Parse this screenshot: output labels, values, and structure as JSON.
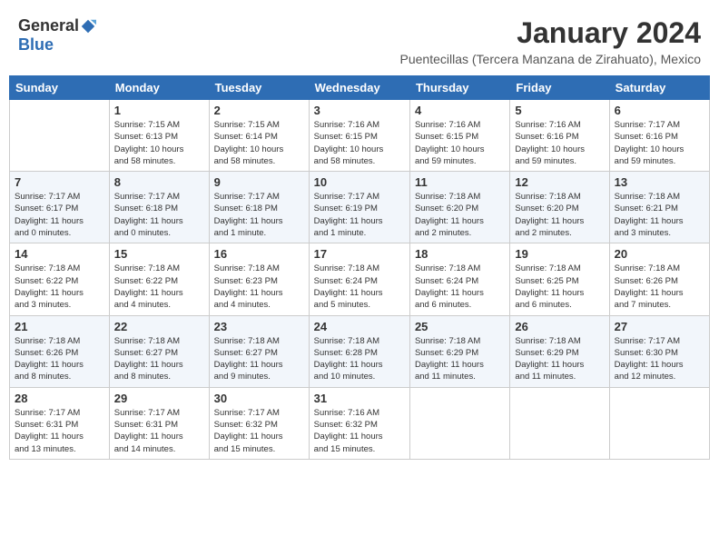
{
  "header": {
    "logo_general": "General",
    "logo_blue": "Blue",
    "month_title": "January 2024",
    "location": "Puentecillas (Tercera Manzana de Zirahuato), Mexico"
  },
  "days_of_week": [
    "Sunday",
    "Monday",
    "Tuesday",
    "Wednesday",
    "Thursday",
    "Friday",
    "Saturday"
  ],
  "weeks": [
    [
      {
        "day": "",
        "info": ""
      },
      {
        "day": "1",
        "info": "Sunrise: 7:15 AM\nSunset: 6:13 PM\nDaylight: 10 hours\nand 58 minutes."
      },
      {
        "day": "2",
        "info": "Sunrise: 7:15 AM\nSunset: 6:14 PM\nDaylight: 10 hours\nand 58 minutes."
      },
      {
        "day": "3",
        "info": "Sunrise: 7:16 AM\nSunset: 6:15 PM\nDaylight: 10 hours\nand 58 minutes."
      },
      {
        "day": "4",
        "info": "Sunrise: 7:16 AM\nSunset: 6:15 PM\nDaylight: 10 hours\nand 59 minutes."
      },
      {
        "day": "5",
        "info": "Sunrise: 7:16 AM\nSunset: 6:16 PM\nDaylight: 10 hours\nand 59 minutes."
      },
      {
        "day": "6",
        "info": "Sunrise: 7:17 AM\nSunset: 6:16 PM\nDaylight: 10 hours\nand 59 minutes."
      }
    ],
    [
      {
        "day": "7",
        "info": "Sunrise: 7:17 AM\nSunset: 6:17 PM\nDaylight: 11 hours\nand 0 minutes."
      },
      {
        "day": "8",
        "info": "Sunrise: 7:17 AM\nSunset: 6:18 PM\nDaylight: 11 hours\nand 0 minutes."
      },
      {
        "day": "9",
        "info": "Sunrise: 7:17 AM\nSunset: 6:18 PM\nDaylight: 11 hours\nand 1 minute."
      },
      {
        "day": "10",
        "info": "Sunrise: 7:17 AM\nSunset: 6:19 PM\nDaylight: 11 hours\nand 1 minute."
      },
      {
        "day": "11",
        "info": "Sunrise: 7:18 AM\nSunset: 6:20 PM\nDaylight: 11 hours\nand 2 minutes."
      },
      {
        "day": "12",
        "info": "Sunrise: 7:18 AM\nSunset: 6:20 PM\nDaylight: 11 hours\nand 2 minutes."
      },
      {
        "day": "13",
        "info": "Sunrise: 7:18 AM\nSunset: 6:21 PM\nDaylight: 11 hours\nand 3 minutes."
      }
    ],
    [
      {
        "day": "14",
        "info": "Sunrise: 7:18 AM\nSunset: 6:22 PM\nDaylight: 11 hours\nand 3 minutes."
      },
      {
        "day": "15",
        "info": "Sunrise: 7:18 AM\nSunset: 6:22 PM\nDaylight: 11 hours\nand 4 minutes."
      },
      {
        "day": "16",
        "info": "Sunrise: 7:18 AM\nSunset: 6:23 PM\nDaylight: 11 hours\nand 4 minutes."
      },
      {
        "day": "17",
        "info": "Sunrise: 7:18 AM\nSunset: 6:24 PM\nDaylight: 11 hours\nand 5 minutes."
      },
      {
        "day": "18",
        "info": "Sunrise: 7:18 AM\nSunset: 6:24 PM\nDaylight: 11 hours\nand 6 minutes."
      },
      {
        "day": "19",
        "info": "Sunrise: 7:18 AM\nSunset: 6:25 PM\nDaylight: 11 hours\nand 6 minutes."
      },
      {
        "day": "20",
        "info": "Sunrise: 7:18 AM\nSunset: 6:26 PM\nDaylight: 11 hours\nand 7 minutes."
      }
    ],
    [
      {
        "day": "21",
        "info": "Sunrise: 7:18 AM\nSunset: 6:26 PM\nDaylight: 11 hours\nand 8 minutes."
      },
      {
        "day": "22",
        "info": "Sunrise: 7:18 AM\nSunset: 6:27 PM\nDaylight: 11 hours\nand 8 minutes."
      },
      {
        "day": "23",
        "info": "Sunrise: 7:18 AM\nSunset: 6:27 PM\nDaylight: 11 hours\nand 9 minutes."
      },
      {
        "day": "24",
        "info": "Sunrise: 7:18 AM\nSunset: 6:28 PM\nDaylight: 11 hours\nand 10 minutes."
      },
      {
        "day": "25",
        "info": "Sunrise: 7:18 AM\nSunset: 6:29 PM\nDaylight: 11 hours\nand 11 minutes."
      },
      {
        "day": "26",
        "info": "Sunrise: 7:18 AM\nSunset: 6:29 PM\nDaylight: 11 hours\nand 11 minutes."
      },
      {
        "day": "27",
        "info": "Sunrise: 7:17 AM\nSunset: 6:30 PM\nDaylight: 11 hours\nand 12 minutes."
      }
    ],
    [
      {
        "day": "28",
        "info": "Sunrise: 7:17 AM\nSunset: 6:31 PM\nDaylight: 11 hours\nand 13 minutes."
      },
      {
        "day": "29",
        "info": "Sunrise: 7:17 AM\nSunset: 6:31 PM\nDaylight: 11 hours\nand 14 minutes."
      },
      {
        "day": "30",
        "info": "Sunrise: 7:17 AM\nSunset: 6:32 PM\nDaylight: 11 hours\nand 15 minutes."
      },
      {
        "day": "31",
        "info": "Sunrise: 7:16 AM\nSunset: 6:32 PM\nDaylight: 11 hours\nand 15 minutes."
      },
      {
        "day": "",
        "info": ""
      },
      {
        "day": "",
        "info": ""
      },
      {
        "day": "",
        "info": ""
      }
    ]
  ]
}
